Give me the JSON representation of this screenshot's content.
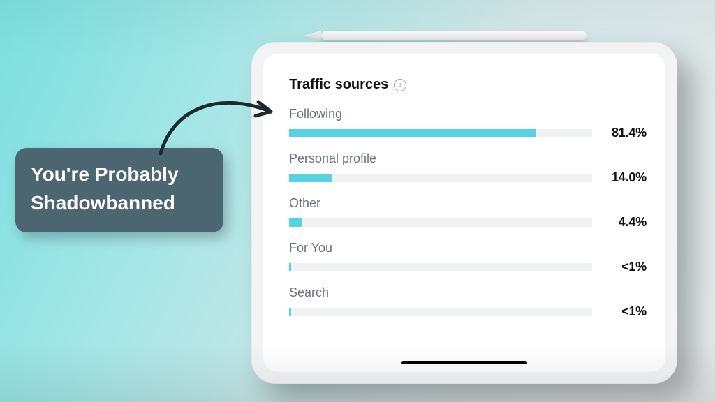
{
  "callout": {
    "text": "You're Probably Shadowbanned"
  },
  "section": {
    "title": "Traffic sources",
    "info_label": "i"
  },
  "metrics": [
    {
      "label": "Following",
      "value_display": "81.4%",
      "fill_pct": 81.4
    },
    {
      "label": "Personal profile",
      "value_display": "14.0%",
      "fill_pct": 14.0
    },
    {
      "label": "Other",
      "value_display": "4.4%",
      "fill_pct": 4.4
    },
    {
      "label": "For You",
      "value_display": "<1%",
      "fill_pct": 0.6
    },
    {
      "label": "Search",
      "value_display": "<1%",
      "fill_pct": 0.6
    }
  ],
  "colors": {
    "bar_fill": "#57d2e3",
    "track": "#f1f2f3",
    "callout_bg": "#4b6671"
  },
  "chart_data": {
    "type": "bar",
    "title": "Traffic sources",
    "xlabel": "",
    "ylabel": "",
    "ylim": [
      0,
      100
    ],
    "categories": [
      "Following",
      "Personal profile",
      "Other",
      "For You",
      "Search"
    ],
    "values": [
      81.4,
      14.0,
      4.4,
      0.5,
      0.5
    ],
    "value_labels": [
      "81.4%",
      "14.0%",
      "4.4%",
      "<1%",
      "<1%"
    ]
  }
}
